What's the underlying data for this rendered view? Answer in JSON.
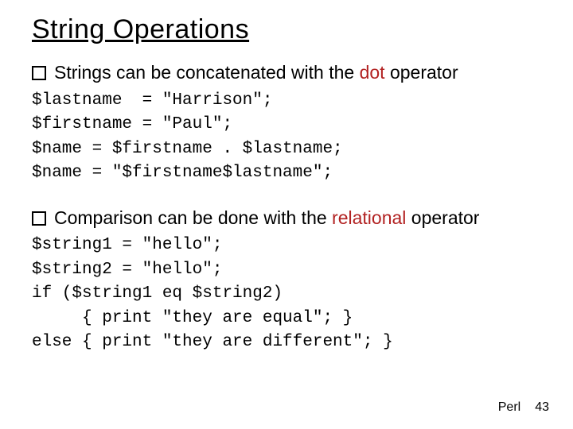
{
  "title": "String Operations",
  "section1": {
    "bullet_pre": "Strings can be concatenated with the ",
    "bullet_keyword": "dot",
    "bullet_post": " operator",
    "code": "$lastname  = \"Harrison\";\n$firstname = \"Paul\";\n$name = $firstname . $lastname;\n$name = \"$firstname$lastname\";"
  },
  "section2": {
    "bullet_pre": "Comparison can be done with the ",
    "bullet_keyword": "relational",
    "bullet_post": " operator",
    "code": "$string1 = \"hello\";\n$string2 = \"hello\";\nif ($string1 eq $string2)\n     { print \"they are equal\"; }\nelse { print \"they are different\"; }"
  },
  "footer": {
    "label": "Perl",
    "page": "43"
  }
}
